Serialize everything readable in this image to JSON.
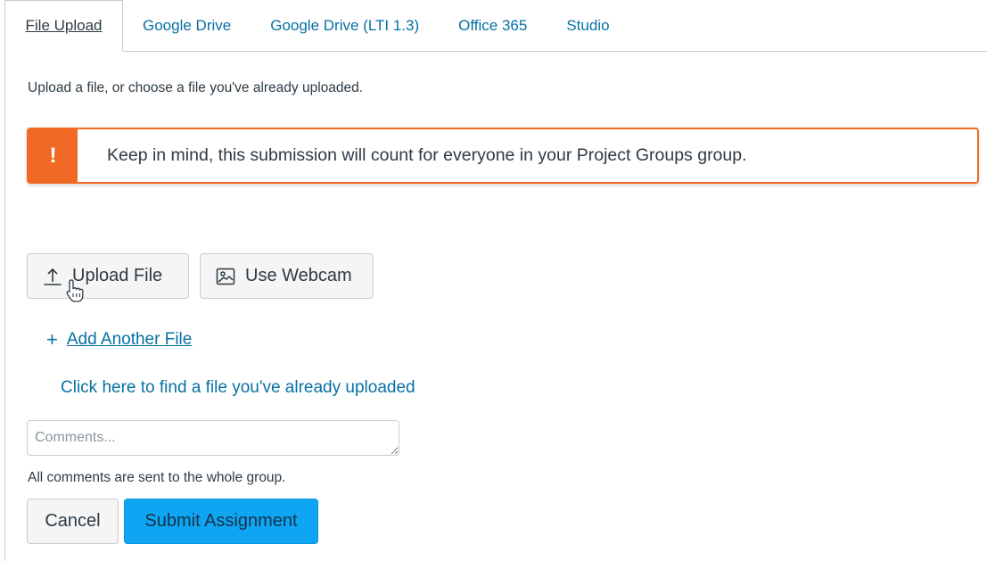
{
  "tabs": [
    {
      "label": "File Upload",
      "active": true
    },
    {
      "label": "Google Drive"
    },
    {
      "label": "Google Drive (LTI 1.3)"
    },
    {
      "label": "Office 365"
    },
    {
      "label": "Studio"
    }
  ],
  "intro": "Upload a file, or choose a file you've already uploaded.",
  "alert": {
    "icon": "!",
    "text": "Keep in mind, this submission will count for everyone in your Project Groups group."
  },
  "buttons": {
    "upload": "Upload File",
    "webcam": "Use Webcam",
    "add_file": "Add Another File",
    "add_file_icon": "+",
    "find_file": "Click here to find a file you've already uploaded",
    "cancel": "Cancel",
    "submit": "Submit Assignment"
  },
  "comments": {
    "placeholder": "Comments...",
    "note": "All comments are sent to the whole group."
  },
  "colors": {
    "link": "#0770a3",
    "alert": "#f06a26",
    "submit": "#0ea5f3"
  },
  "icons": [
    "upload-icon",
    "image-icon",
    "plus-icon",
    "hand-cursor-icon"
  ]
}
